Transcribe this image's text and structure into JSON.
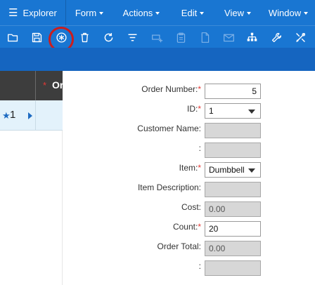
{
  "menubar": {
    "explorer_label": "Explorer",
    "menus": [
      {
        "label": "Form"
      },
      {
        "label": "Actions"
      },
      {
        "label": "Edit"
      },
      {
        "label": "View"
      },
      {
        "label": "Window"
      }
    ]
  },
  "toolbar": {
    "buttons": [
      {
        "icon": "folder-open-icon"
      },
      {
        "icon": "save-icon"
      },
      {
        "icon": "new-record-icon",
        "highlighted": true
      },
      {
        "icon": "delete-icon"
      },
      {
        "icon": "refresh-icon"
      },
      {
        "icon": "filter-icon"
      },
      {
        "icon": "add-row-icon"
      },
      {
        "icon": "clipboard-icon"
      },
      {
        "icon": "document-icon"
      },
      {
        "icon": "email-icon"
      },
      {
        "icon": "hierarchy-icon"
      },
      {
        "icon": "wrench-icon"
      },
      {
        "icon": "tools-icon"
      }
    ]
  },
  "grid": {
    "header": {
      "required_mark": "*",
      "column_label": "Or"
    },
    "rows": [
      {
        "number": "1"
      }
    ]
  },
  "form": {
    "order_number": {
      "label": "Order Number:",
      "required": "*",
      "value": "5"
    },
    "id": {
      "label": "ID:",
      "required": "*",
      "value": "1"
    },
    "customer_name": {
      "label": "Customer Name:",
      "value": ""
    },
    "unnamed_1": {
      "label": ":",
      "value": ""
    },
    "item": {
      "label": "Item:",
      "required": "*",
      "value": "Dumbbell"
    },
    "item_description": {
      "label": "Item Description:",
      "value": ""
    },
    "cost": {
      "label": "Cost:",
      "value": "0.00"
    },
    "count": {
      "label": "Count:",
      "required": "*",
      "value": "20"
    },
    "order_total": {
      "label": "Order Total:",
      "value": "0.00"
    },
    "unnamed_2": {
      "label": ":",
      "value": ""
    }
  },
  "colors": {
    "menubar": "#1976d2",
    "band": "#1565c0",
    "highlight_ring": "#cc1d1d",
    "required": "#e53935",
    "grid_header": "#3d3d3d",
    "grid_row": "#e3f2fb"
  }
}
